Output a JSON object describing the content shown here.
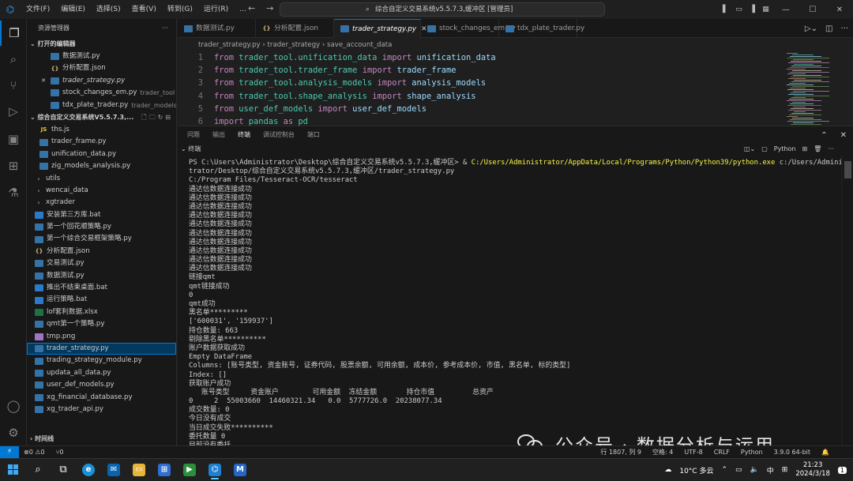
{
  "titlebar": {
    "menu": [
      "文件(F)",
      "编辑(E)",
      "选择(S)",
      "查看(V)",
      "转到(G)",
      "运行(R)",
      "..."
    ],
    "search_text": "综合自定义交易系统v5.5.7.3,缓冲区 [管理员]"
  },
  "sidebar": {
    "title": "资源管理器",
    "open_editors_label": "打开的编辑器",
    "open_editors": [
      {
        "name": "数据测试.py",
        "icon": "py",
        "desc": ""
      },
      {
        "name": "分析配置.json",
        "icon": "json",
        "desc": ""
      },
      {
        "name": "trader_strategy.py",
        "icon": "py",
        "desc": "",
        "active": true
      },
      {
        "name": "stock_changes_em.py",
        "icon": "py",
        "desc": "trader_tool"
      },
      {
        "name": "tdx_plate_trader.py",
        "icon": "py",
        "desc": "trader_models\\..."
      }
    ],
    "workspace_label": "综合自定义交易系统V5.5.7.3,...",
    "files": [
      {
        "name": "ths.js",
        "icon": "js",
        "indent": 1
      },
      {
        "name": "trader_frame.py",
        "icon": "py",
        "indent": 1
      },
      {
        "name": "unification_data.py",
        "icon": "py",
        "indent": 1
      },
      {
        "name": "zig_models_analysis.py",
        "icon": "py",
        "indent": 1
      },
      {
        "name": "utils",
        "icon": "chev",
        "indent": 0
      },
      {
        "name": "wencai_data",
        "icon": "chev",
        "indent": 0
      },
      {
        "name": "xgtrader",
        "icon": "chev",
        "indent": 0
      },
      {
        "name": "安装第三方库.bat",
        "icon": "bat",
        "indent": 0
      },
      {
        "name": "第一个回花顺策略.py",
        "icon": "py",
        "indent": 0
      },
      {
        "name": "第一个综合交易框架策略.py",
        "icon": "py",
        "indent": 0
      },
      {
        "name": "分析配置.json",
        "icon": "json",
        "indent": 0
      },
      {
        "name": "交易测试.py",
        "icon": "py",
        "indent": 0
      },
      {
        "name": "数据测试.py",
        "icon": "py",
        "indent": 0
      },
      {
        "name": "推出不结束桌面.bat",
        "icon": "bat",
        "indent": 0
      },
      {
        "name": "运行策略.bat",
        "icon": "bat",
        "indent": 0
      },
      {
        "name": "lof套利数据.xlsx",
        "icon": "xls",
        "indent": 0
      },
      {
        "name": "qmt第一个策略.py",
        "icon": "py",
        "indent": 0
      },
      {
        "name": "tmp.png",
        "icon": "png",
        "indent": 0
      },
      {
        "name": "trader_strategy.py",
        "icon": "py",
        "indent": 0,
        "selected": true
      },
      {
        "name": "trading_strategy_module.py",
        "icon": "py",
        "indent": 0
      },
      {
        "name": "updata_all_data.py",
        "icon": "py",
        "indent": 0
      },
      {
        "name": "user_def_models.py",
        "icon": "py",
        "indent": 0
      },
      {
        "name": "xg_financial_database.py",
        "icon": "py",
        "indent": 0
      },
      {
        "name": "xg_trader_api.py",
        "icon": "py",
        "indent": 0
      }
    ],
    "timeline_label": "时间线"
  },
  "tabs": [
    {
      "label": "数据测试.py",
      "icon": "py"
    },
    {
      "label": "分析配置.json",
      "icon": "json"
    },
    {
      "label": "trader_strategy.py",
      "icon": "py",
      "active": true
    },
    {
      "label": "stock_changes_em.py",
      "icon": "py"
    },
    {
      "label": "tdx_plate_trader.py",
      "icon": "py"
    }
  ],
  "breadcrumb": [
    "trader_strategy.py",
    "trader_strategy",
    "save_account_data"
  ],
  "code": [
    {
      "n": "1",
      "tokens": [
        [
          "kw",
          "from "
        ],
        [
          "mod",
          "trader_tool.unification_data "
        ],
        [
          "kw",
          "import "
        ],
        [
          "id",
          "unification_data"
        ]
      ]
    },
    {
      "n": "2",
      "tokens": [
        [
          "kw",
          "from "
        ],
        [
          "mod",
          "trader_tool.trader_frame "
        ],
        [
          "kw",
          "import "
        ],
        [
          "id",
          "trader_frame"
        ]
      ]
    },
    {
      "n": "3",
      "tokens": [
        [
          "kw",
          "from "
        ],
        [
          "mod",
          "trader_tool.analysis_models "
        ],
        [
          "kw",
          "import "
        ],
        [
          "id",
          "analysis_models"
        ]
      ]
    },
    {
      "n": "4",
      "tokens": [
        [
          "kw",
          "from "
        ],
        [
          "mod",
          "trader_tool.shape_analysis "
        ],
        [
          "kw",
          "import "
        ],
        [
          "id",
          "shape_analysis"
        ]
      ]
    },
    {
      "n": "5",
      "tokens": [
        [
          "kw",
          "from "
        ],
        [
          "mod",
          "user_def_models "
        ],
        [
          "kw",
          "import "
        ],
        [
          "id",
          "user_def_models"
        ]
      ]
    },
    {
      "n": "6",
      "tokens": [
        [
          "kw",
          "import "
        ],
        [
          "mod",
          "pandas "
        ],
        [
          "kw",
          "as "
        ],
        [
          "mod",
          "pd"
        ]
      ]
    }
  ],
  "panel": {
    "tabs": [
      "问题",
      "输出",
      "终端",
      "调试控制台",
      "端口"
    ],
    "active_tab": "终端",
    "terminal_label": "终端",
    "python_label": "Python"
  },
  "terminal_lines": [
    "PS C:\\Users\\Administrator\\Desktop\\综合自定义交易系统v5.5.7.3,缓冲区> & |C:/Users/Administrator/AppData/Local/Programs/Python/Python39/python.exe| c:/Users/Adminis",
    "trator/Desktop/综合自定义交易系统v5.5.7.3,缓冲区/trader_strategy.py",
    "C:/Program Files/Tesseract-OCR/tesseract",
    "通达信数据连接成功",
    "通达信数据连接成功",
    "通达信数据连接成功",
    "通达信数据连接成功",
    "通达信数据连接成功",
    "通达信数据连接成功",
    "通达信数据连接成功",
    "通达信数据连接成功",
    "通达信数据连接成功",
    "通达信数据连接成功",
    "链接qmt",
    "qmt链接成功",
    "0",
    "qmt成功",
    "黑名单*********",
    "['600031', '159937']",
    "持仓数量: 663",
    "剔除黑名单**********",
    "账户数据获取成功",
    "Empty DataFrame",
    "Columns: [账号类型, 资金账号, 证券代码, 股票余额, 可用余额, 成本价, 参考成本价, 市值, 黑名单, 标的类型]",
    "Index: []",
    "获取账户成功",
    "   账号类型     资金账户        可用金额  冻结金额       持仓市值         总资产",
    "0     2  55003660  14460321.34   0.0  5777726.0  20238077.34",
    "成交数量: 0",
    "今日没有成交",
    "当日成交失败**********",
    "委托数量 0",
    "目前没有委托"
  ],
  "statusbar": {
    "remote": "⚡",
    "errors": "⊗0 ⚠0",
    "ports": "⑂0",
    "right": [
      "行 1807, 列 9",
      "空格: 4",
      "UTF-8",
      "CRLF",
      "Python",
      "3.9.0 64-bit"
    ]
  },
  "watermark": "公众号 · 数据分析与运用",
  "taskbar": {
    "weather": "10°C 多云",
    "ime": "中",
    "time": "21:23",
    "date": "2024/3/18",
    "notifications": "1"
  }
}
